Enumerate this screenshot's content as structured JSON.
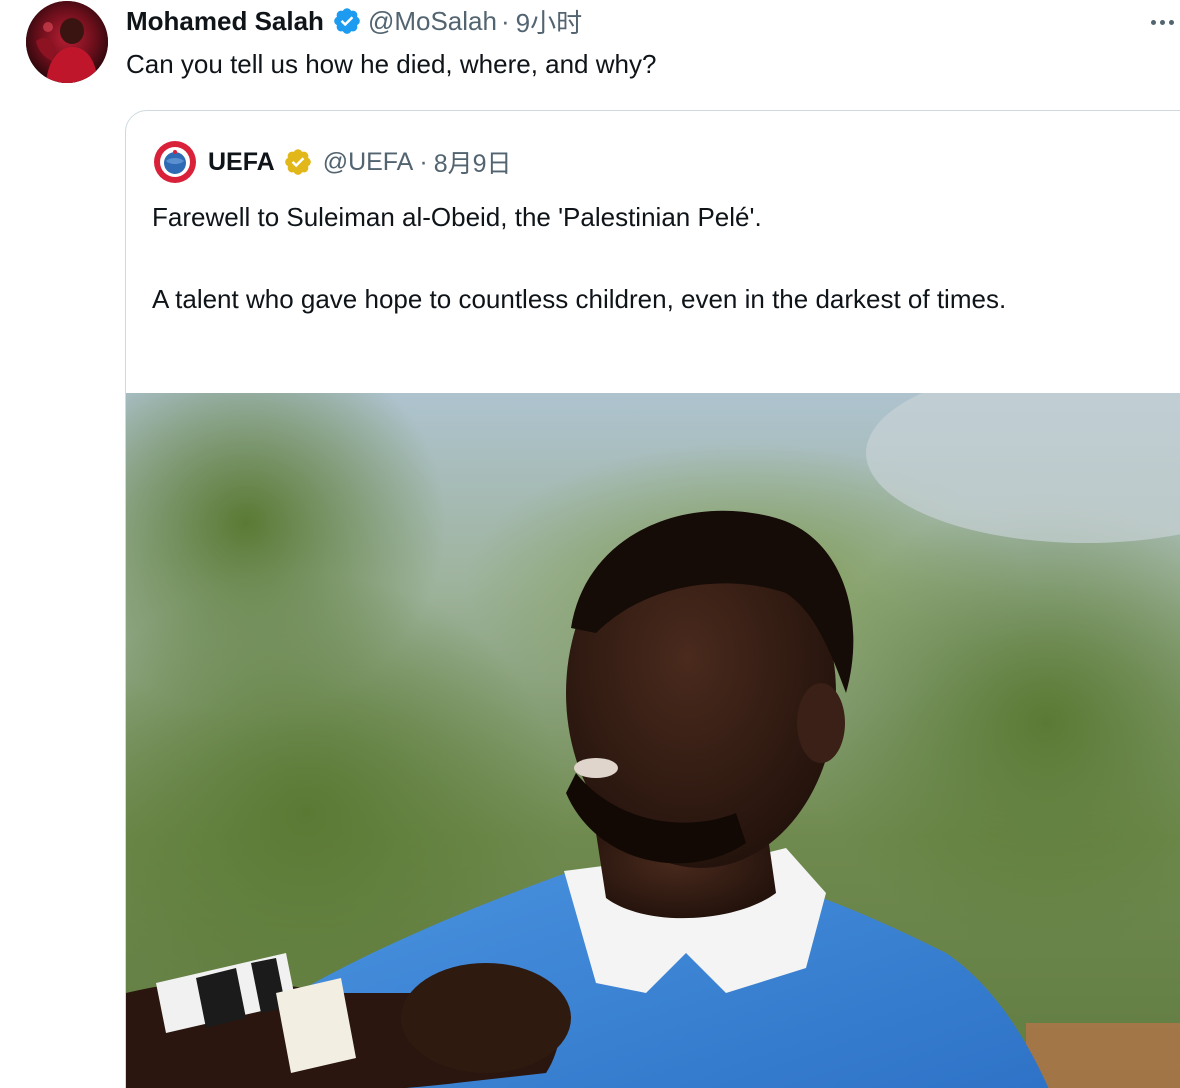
{
  "tweet": {
    "author_name": "Mohamed Salah",
    "author_handle": "@MoSalah",
    "separator": "·",
    "time": "9小时",
    "text": "Can you tell us how he died, where, and why?",
    "icons": {
      "verified": "verified-badge-icon",
      "more": "more-options-icon"
    }
  },
  "quote": {
    "author_name": "UEFA",
    "author_handle": "@UEFA",
    "separator": "·",
    "time": "8月9日",
    "paragraphs": [
      "Farewell to Suleiman al-Obeid, the 'Palestinian Pelé'.",
      "A talent who gave hope to countless children, even in the darkest of times."
    ],
    "icons": {
      "logo": "uefa-logo-icon",
      "verified": "gold-verified-badge-icon"
    },
    "media": "photo-of-footballer-in-blue-shirt"
  },
  "colors": {
    "text_primary": "#0f1419",
    "text_secondary": "#536471",
    "verified_blue": "#1d9bf0",
    "verified_gold": "#e2b719",
    "card_border": "#cfd9de"
  }
}
